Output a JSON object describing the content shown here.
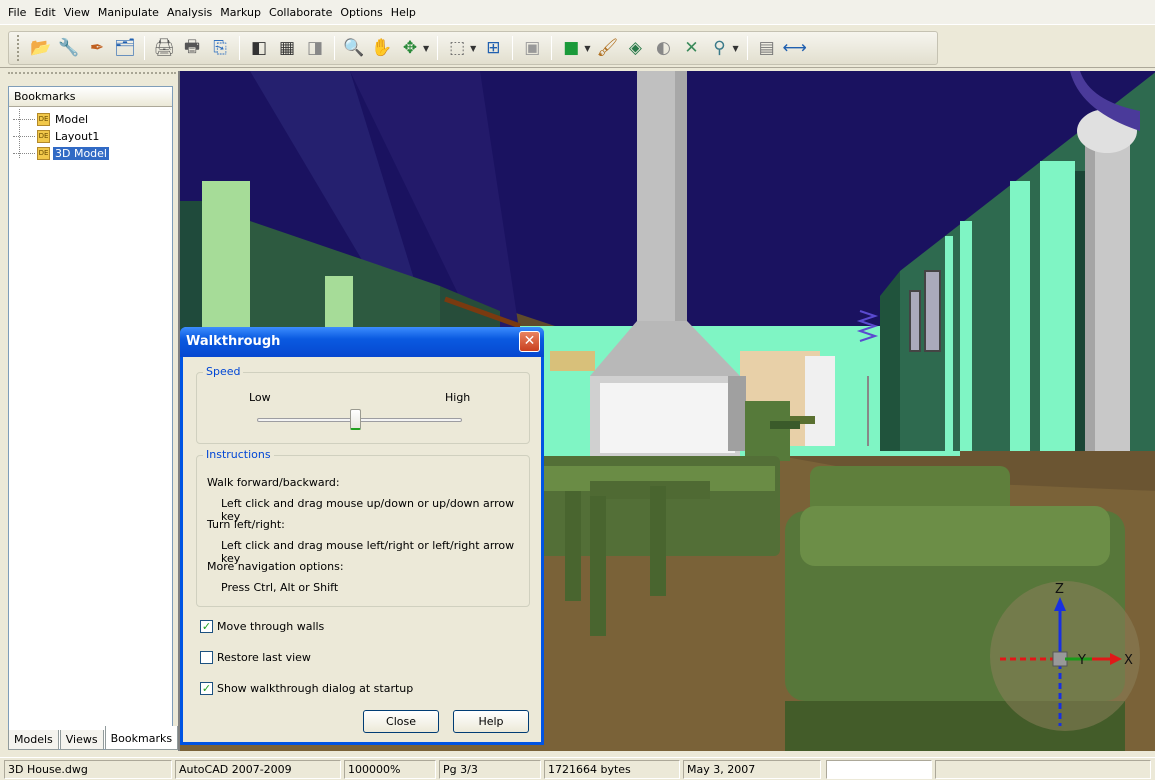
{
  "menu": [
    "File",
    "Edit",
    "View",
    "Manipulate",
    "Analysis",
    "Markup",
    "Collaborate",
    "Options",
    "Help"
  ],
  "toolbar": {
    "open_icon": "📂",
    "publish_icon": "🔧",
    "pen_icon": "✒",
    "tree_icon": "🗂",
    "print_icon": "🖨",
    "print2_icon": "🖶",
    "copy_icon": "⎘",
    "page_prev_icon": "◧",
    "page_grid_icon": "▦",
    "page_next_icon": "◨",
    "zoom_icon": "🔍",
    "pan_icon": "✋",
    "orbit_icon": "✥",
    "zoomwin_icon": "⬚",
    "fit_icon": "⊞",
    "camera_icon": "▣",
    "cube_icon": "■",
    "brush_icon": "🖌",
    "wire_icon": "◈",
    "section_icon": "◐",
    "explode_icon": "✕",
    "walk_icon": "⚲",
    "props_icon": "▤",
    "measure_icon": "⟷"
  },
  "left_panel": {
    "header": "Bookmarks",
    "items": [
      {
        "label": "Model",
        "selected": false
      },
      {
        "label": "Layout1",
        "selected": false
      },
      {
        "label": "3D Model",
        "selected": true
      }
    ],
    "tabs": [
      "Models",
      "Views",
      "Bookmarks"
    ],
    "active_tab": "Bookmarks"
  },
  "dialog": {
    "title": "Walkthrough",
    "close_glyph": "✕",
    "speed_group": "Speed",
    "speed_low": "Low",
    "speed_high": "High",
    "speed_level": 0.48,
    "instructions_group": "Instructions",
    "instructions": [
      "Walk forward/backward:",
      "Left click and drag mouse up/down or up/down arrow key",
      "Turn left/right:",
      "Left click and drag mouse left/right or left/right arrow key",
      "More navigation options:",
      "Press Ctrl, Alt or Shift"
    ],
    "checkboxes": [
      {
        "label": "Move through walls",
        "checked": true
      },
      {
        "label": "Restore last view",
        "checked": false
      },
      {
        "label": "Show walkthrough dialog at startup",
        "checked": true
      }
    ],
    "close_button": "Close",
    "help_button": "Help"
  },
  "axes": {
    "z": "Z",
    "y": "Y",
    "x": "X"
  },
  "status": {
    "file": "3D House.dwg",
    "format": "AutoCAD 2007-2009",
    "zoom": "100000%",
    "page": "Pg 3/3",
    "size": "1721664 bytes",
    "date": "May 3, 2007",
    "extra": ""
  },
  "colors": {
    "sky": "#1a1260",
    "wall_green": "#2e6a4f",
    "mint": "#7ff5c4",
    "floor": "#6b5532",
    "furniture": "#4e6d35",
    "selection": "#316ac5",
    "xp_blue": "#0054e3"
  }
}
